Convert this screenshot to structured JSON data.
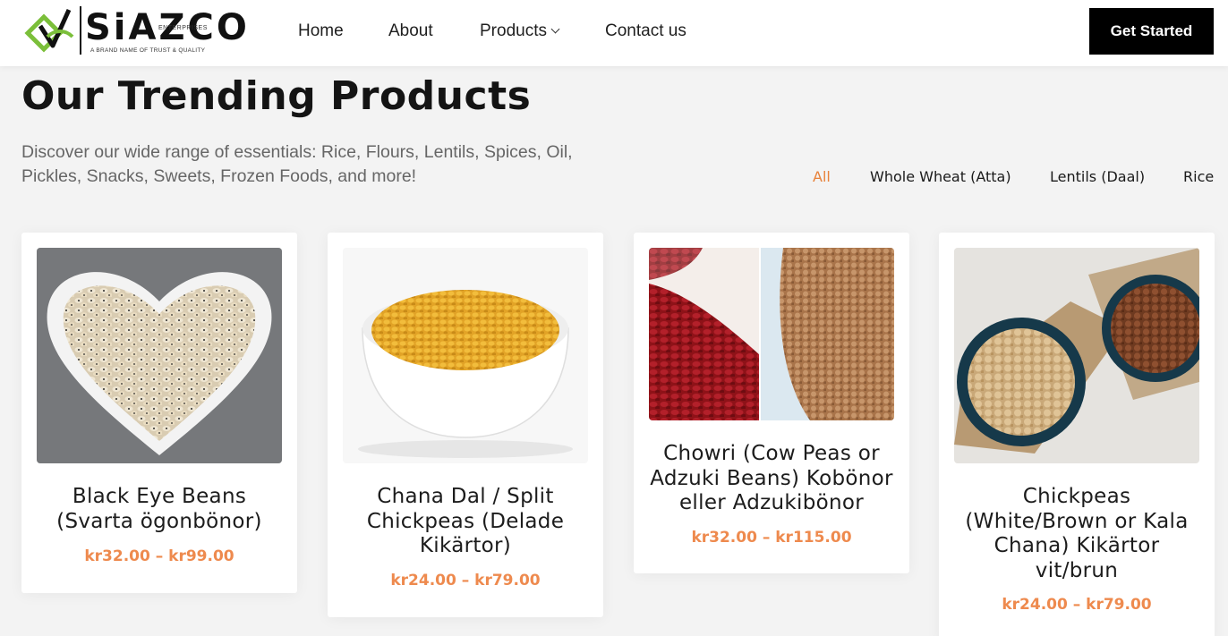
{
  "brand": {
    "name": "SiAZCO",
    "sub": "ENTERPRISES",
    "tagline": "A BRAND NAME OF TRUST & QUALITY",
    "colors": {
      "green": "#7bbf3a",
      "dark": "#111111"
    }
  },
  "nav": {
    "home": "Home",
    "about": "About",
    "products": "Products",
    "contact": "Contact us",
    "cta": "Get Started"
  },
  "section": {
    "title": "Our Trending Products",
    "subtitle": "Discover our wide range of essentials: Rice, Flours, Lentils, Spices, Oil, Pickles, Snacks, Sweets, Frozen Foods, and more!"
  },
  "filters": [
    "All",
    "Whole Wheat (Atta)",
    "Lentils (Daal)",
    "Rice"
  ],
  "accent": "#ee8a4e",
  "products": [
    {
      "title": "Black Eye Beans (Svarta ögonbönor)",
      "price": "kr32.00 – kr99.00",
      "image": "heart-bowl-black-eye-beans"
    },
    {
      "title": "Chana Dal / Split Chickpeas (Delade Kikärtor)",
      "price": "kr24.00 – kr79.00",
      "image": "white-bowl-chana-dal"
    },
    {
      "title": "Chowri (Cow Peas or Adzuki Beans) Kobönor eller Adzukibönor",
      "price": "kr32.00 – kr115.00",
      "image": "red-and-brown-beans"
    },
    {
      "title": "Chickpeas (White/Brown or Kala Chana) Kikärtor vit/brun",
      "price": "kr24.00 – kr79.00",
      "image": "blue-bowls-chickpeas"
    }
  ]
}
